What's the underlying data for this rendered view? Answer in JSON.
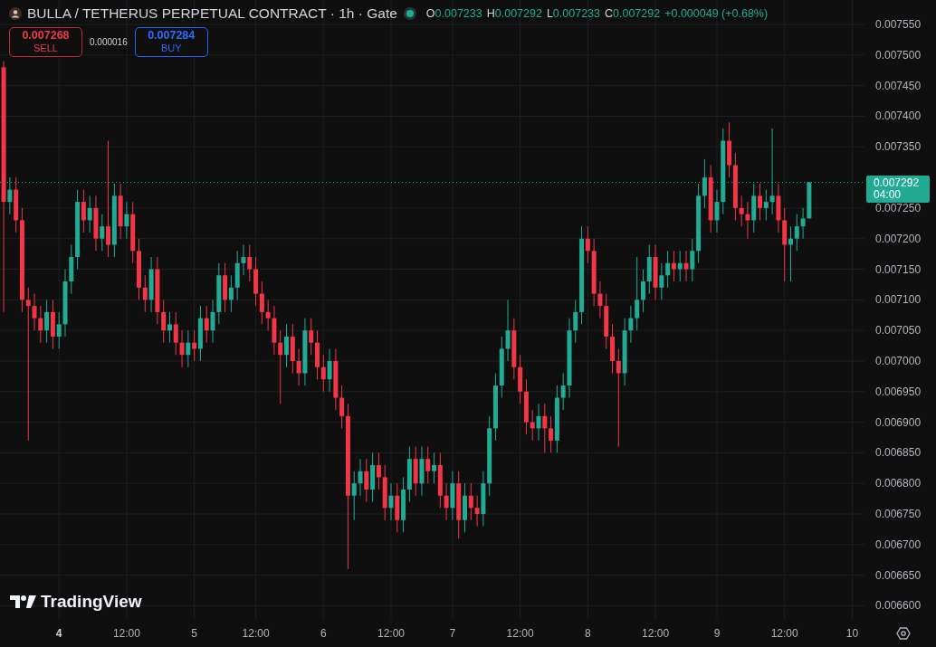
{
  "header": {
    "title": "BULLA / TETHERUS PERPETUAL CONTRACT · 1h · Gate",
    "ohlc": [
      {
        "label": "O",
        "value": "0.007233"
      },
      {
        "label": "H",
        "value": "0.007292"
      },
      {
        "label": "L",
        "value": "0.007233"
      },
      {
        "label": "C",
        "value": "0.007292"
      }
    ],
    "change": "+0.000049 (+0.68%)"
  },
  "trade": {
    "sell": {
      "price": "0.007268",
      "label": "SELL"
    },
    "spread": "0.000016",
    "buy": {
      "price": "0.007284",
      "label": "BUY"
    }
  },
  "chart": {
    "current": {
      "countdown": "04:00"
    },
    "chart_data": {
      "type": "candlestick",
      "ylim": [
        0.006577,
        0.00759
      ],
      "grid": true,
      "ref_lines": [
        {
          "axis": "y",
          "value": 0.007292,
          "label": "0.007292",
          "color": "#22ab94"
        }
      ],
      "categories": [
        null,
        null,
        null,
        null,
        null,
        null,
        null,
        null,
        null,
        "4",
        null,
        null,
        null,
        null,
        null,
        null,
        null,
        null,
        null,
        null,
        "12:00",
        null,
        null,
        null,
        null,
        null,
        null,
        null,
        null,
        null,
        null,
        "5",
        null,
        null,
        null,
        null,
        null,
        null,
        null,
        null,
        null,
        "12:00",
        null,
        null,
        null,
        null,
        null,
        null,
        null,
        null,
        null,
        null,
        "6",
        null,
        null,
        null,
        null,
        null,
        null,
        null,
        null,
        null,
        null,
        "12:00",
        null,
        null,
        null,
        null,
        null,
        null,
        null,
        null,
        null,
        "7",
        null,
        null,
        null,
        null,
        null,
        null,
        null,
        null,
        null,
        null,
        "12:00",
        null,
        null,
        null,
        null,
        null,
        null,
        null,
        null,
        null,
        null,
        "8",
        null,
        null,
        null,
        null,
        null,
        null,
        null,
        null,
        null,
        null,
        "12:00",
        null,
        null,
        null,
        null,
        null,
        null,
        null,
        null,
        null,
        "9",
        null,
        null,
        null,
        null,
        null,
        null,
        null,
        null,
        null,
        null,
        "12:00",
        null,
        null,
        null,
        null,
        null,
        null,
        null,
        null,
        null,
        null,
        "10"
      ],
      "yticks": [
        {
          "value": 0.00755,
          "label": "0.007550"
        },
        {
          "value": 0.0075,
          "label": "0.007500"
        },
        {
          "value": 0.00745,
          "label": "0.007450"
        },
        {
          "value": 0.0074,
          "label": "0.007400"
        },
        {
          "value": 0.00735,
          "label": "0.007350"
        },
        {
          "value": 0.00725,
          "label": "0.007250"
        },
        {
          "value": 0.0072,
          "label": "0.007200"
        },
        {
          "value": 0.00715,
          "label": "0.007150"
        },
        {
          "value": 0.0071,
          "label": "0.007100"
        },
        {
          "value": 0.00705,
          "label": "0.007050"
        },
        {
          "value": 0.007,
          "label": "0.007000"
        },
        {
          "value": 0.00695,
          "label": "0.006950"
        },
        {
          "value": 0.0069,
          "label": "0.006900"
        },
        {
          "value": 0.00685,
          "label": "0.006850"
        },
        {
          "value": 0.0068,
          "label": "0.006800"
        },
        {
          "value": 0.00675,
          "label": "0.006750"
        },
        {
          "value": 0.0067,
          "label": "0.006700"
        },
        {
          "value": 0.00665,
          "label": "0.006650"
        },
        {
          "value": 0.0066,
          "label": "0.006600"
        }
      ],
      "ohlc": [
        [
          0.00748,
          0.00749,
          0.00708,
          0.00726
        ],
        [
          0.00726,
          0.0073,
          0.00724,
          0.00728
        ],
        [
          0.00728,
          0.0073,
          0.00721,
          0.00723
        ],
        [
          0.00723,
          0.00725,
          0.00708,
          0.0071
        ],
        [
          0.0071,
          0.00712,
          0.00687,
          0.00709
        ],
        [
          0.00709,
          0.00711,
          0.00705,
          0.00707
        ],
        [
          0.00707,
          0.00709,
          0.00703,
          0.00705
        ],
        [
          0.00705,
          0.0071,
          0.00703,
          0.00708
        ],
        [
          0.00708,
          0.0071,
          0.00702,
          0.00704
        ],
        [
          0.00704,
          0.00708,
          0.00702,
          0.00706
        ],
        [
          0.00706,
          0.00715,
          0.00704,
          0.00713
        ],
        [
          0.00713,
          0.00719,
          0.00711,
          0.00717
        ],
        [
          0.00717,
          0.00728,
          0.00715,
          0.00726
        ],
        [
          0.00726,
          0.00728,
          0.00721,
          0.00723
        ],
        [
          0.00723,
          0.00727,
          0.00721,
          0.00725
        ],
        [
          0.00725,
          0.00727,
          0.00718,
          0.0072
        ],
        [
          0.0072,
          0.00724,
          0.00718,
          0.00722
        ],
        [
          0.00722,
          0.00736,
          0.00717,
          0.00719
        ],
        [
          0.00719,
          0.00729,
          0.00717,
          0.00727
        ],
        [
          0.00727,
          0.00729,
          0.0072,
          0.00722
        ],
        [
          0.00722,
          0.00726,
          0.0072,
          0.00724
        ],
        [
          0.00724,
          0.00726,
          0.00716,
          0.00718
        ],
        [
          0.00718,
          0.0072,
          0.0071,
          0.00712
        ],
        [
          0.00712,
          0.00714,
          0.00708,
          0.0071
        ],
        [
          0.0071,
          0.00717,
          0.00708,
          0.00715
        ],
        [
          0.00715,
          0.00717,
          0.00706,
          0.00708
        ],
        [
          0.00708,
          0.0071,
          0.00703,
          0.00705
        ],
        [
          0.00705,
          0.00708,
          0.00703,
          0.00706
        ],
        [
          0.00706,
          0.00708,
          0.00701,
          0.00703
        ],
        [
          0.00703,
          0.00705,
          0.00699,
          0.00701
        ],
        [
          0.00701,
          0.00705,
          0.00699,
          0.00703
        ],
        [
          0.00703,
          0.00705,
          0.007,
          0.00702
        ],
        [
          0.00702,
          0.00709,
          0.007,
          0.00707
        ],
        [
          0.00707,
          0.00709,
          0.00703,
          0.00705
        ],
        [
          0.00705,
          0.0071,
          0.00703,
          0.00708
        ],
        [
          0.00708,
          0.00716,
          0.00706,
          0.00714
        ],
        [
          0.00714,
          0.00716,
          0.00708,
          0.0071
        ],
        [
          0.0071,
          0.00714,
          0.00708,
          0.00712
        ],
        [
          0.00712,
          0.00718,
          0.0071,
          0.00716
        ],
        [
          0.00716,
          0.00719,
          0.00714,
          0.00717
        ],
        [
          0.00717,
          0.00719,
          0.00713,
          0.00715
        ],
        [
          0.00715,
          0.00717,
          0.00709,
          0.00711
        ],
        [
          0.00711,
          0.00713,
          0.00706,
          0.00708
        ],
        [
          0.00708,
          0.0071,
          0.00705,
          0.00707
        ],
        [
          0.00707,
          0.00709,
          0.00701,
          0.00703
        ],
        [
          0.00703,
          0.00705,
          0.00693,
          0.00701
        ],
        [
          0.00701,
          0.00706,
          0.00699,
          0.00704
        ],
        [
          0.00704,
          0.00706,
          0.00698,
          0.007
        ],
        [
          0.007,
          0.00702,
          0.00696,
          0.00698
        ],
        [
          0.00698,
          0.00707,
          0.00696,
          0.00705
        ],
        [
          0.00705,
          0.00707,
          0.00701,
          0.00703
        ],
        [
          0.00703,
          0.00705,
          0.00697,
          0.00699
        ],
        [
          0.00699,
          0.00701,
          0.00695,
          0.00697
        ],
        [
          0.00697,
          0.00702,
          0.00695,
          0.007
        ],
        [
          0.007,
          0.00702,
          0.00692,
          0.00694
        ],
        [
          0.00694,
          0.00696,
          0.00689,
          0.00691
        ],
        [
          0.00691,
          0.00693,
          0.00666,
          0.00678
        ],
        [
          0.00678,
          0.00682,
          0.00674,
          0.0068
        ],
        [
          0.0068,
          0.00684,
          0.00678,
          0.00682
        ],
        [
          0.00682,
          0.00684,
          0.00677,
          0.00679
        ],
        [
          0.00679,
          0.00685,
          0.00677,
          0.00683
        ],
        [
          0.00683,
          0.00685,
          0.00679,
          0.00681
        ],
        [
          0.00681,
          0.00683,
          0.00674,
          0.00676
        ],
        [
          0.00676,
          0.0068,
          0.00674,
          0.00678
        ],
        [
          0.00678,
          0.0068,
          0.00672,
          0.00674
        ],
        [
          0.00674,
          0.00681,
          0.00672,
          0.00679
        ],
        [
          0.00679,
          0.00686,
          0.00677,
          0.00684
        ],
        [
          0.00684,
          0.00686,
          0.00678,
          0.0068
        ],
        [
          0.0068,
          0.00686,
          0.00678,
          0.00684
        ],
        [
          0.00684,
          0.00686,
          0.0068,
          0.00682
        ],
        [
          0.00682,
          0.00685,
          0.0068,
          0.00683
        ],
        [
          0.00683,
          0.00685,
          0.00676,
          0.00678
        ],
        [
          0.00678,
          0.0068,
          0.00674,
          0.00676
        ],
        [
          0.00676,
          0.00682,
          0.00674,
          0.0068
        ],
        [
          0.0068,
          0.00682,
          0.00671,
          0.00674
        ],
        [
          0.00674,
          0.0068,
          0.00672,
          0.00678
        ],
        [
          0.00678,
          0.0068,
          0.00674,
          0.00676
        ],
        [
          0.00676,
          0.00678,
          0.00673,
          0.00675
        ],
        [
          0.00675,
          0.00682,
          0.00673,
          0.0068
        ],
        [
          0.0068,
          0.00691,
          0.00678,
          0.00689
        ],
        [
          0.00689,
          0.00698,
          0.00687,
          0.00696
        ],
        [
          0.00696,
          0.00704,
          0.00694,
          0.00702
        ],
        [
          0.00702,
          0.0071,
          0.007,
          0.00705
        ],
        [
          0.00705,
          0.00707,
          0.00697,
          0.00699
        ],
        [
          0.00699,
          0.00701,
          0.00693,
          0.00695
        ],
        [
          0.00695,
          0.00697,
          0.00688,
          0.0069
        ],
        [
          0.0069,
          0.00692,
          0.00687,
          0.00689
        ],
        [
          0.00689,
          0.00693,
          0.00687,
          0.00691
        ],
        [
          0.00691,
          0.00693,
          0.00685,
          0.00689
        ],
        [
          0.00689,
          0.00691,
          0.00685,
          0.00687
        ],
        [
          0.00687,
          0.00696,
          0.00685,
          0.00694
        ],
        [
          0.00694,
          0.00698,
          0.00692,
          0.00696
        ],
        [
          0.00696,
          0.00707,
          0.00694,
          0.00705
        ],
        [
          0.00705,
          0.0071,
          0.00703,
          0.00708
        ],
        [
          0.00708,
          0.00722,
          0.00706,
          0.0072
        ],
        [
          0.0072,
          0.00722,
          0.00716,
          0.00718
        ],
        [
          0.00718,
          0.0072,
          0.00709,
          0.00711
        ],
        [
          0.00711,
          0.00713,
          0.00707,
          0.00709
        ],
        [
          0.00709,
          0.00711,
          0.00702,
          0.00704
        ],
        [
          0.00704,
          0.00706,
          0.00698,
          0.007
        ],
        [
          0.007,
          0.00702,
          0.00686,
          0.00698
        ],
        [
          0.00698,
          0.00707,
          0.00696,
          0.00705
        ],
        [
          0.00705,
          0.00709,
          0.00703,
          0.00707
        ],
        [
          0.00707,
          0.00717,
          0.00705,
          0.0071
        ],
        [
          0.0071,
          0.00715,
          0.00708,
          0.00713
        ],
        [
          0.00713,
          0.00719,
          0.00711,
          0.00717
        ],
        [
          0.00717,
          0.00719,
          0.0071,
          0.00712
        ],
        [
          0.00712,
          0.00716,
          0.0071,
          0.00714
        ],
        [
          0.00714,
          0.00718,
          0.00712,
          0.00716
        ],
        [
          0.00716,
          0.00718,
          0.00713,
          0.00715
        ],
        [
          0.00715,
          0.00718,
          0.00713,
          0.00716
        ],
        [
          0.00716,
          0.00718,
          0.00713,
          0.00715
        ],
        [
          0.00715,
          0.0072,
          0.00713,
          0.00718
        ],
        [
          0.00718,
          0.00729,
          0.00716,
          0.00727
        ],
        [
          0.00727,
          0.00733,
          0.00725,
          0.0073
        ],
        [
          0.0073,
          0.00732,
          0.00721,
          0.00723
        ],
        [
          0.00723,
          0.00728,
          0.00721,
          0.00726
        ],
        [
          0.00726,
          0.00738,
          0.00724,
          0.00736
        ],
        [
          0.00736,
          0.00739,
          0.0073,
          0.00732
        ],
        [
          0.00732,
          0.00734,
          0.00723,
          0.00725
        ],
        [
          0.00725,
          0.00727,
          0.00722,
          0.00724
        ],
        [
          0.00724,
          0.00726,
          0.0072,
          0.00723
        ],
        [
          0.00723,
          0.00729,
          0.00721,
          0.00727
        ],
        [
          0.00727,
          0.00729,
          0.00723,
          0.00725
        ],
        [
          0.00725,
          0.00728,
          0.00723,
          0.00726
        ],
        [
          0.00726,
          0.00738,
          0.00724,
          0.00727
        ],
        [
          0.00727,
          0.00729,
          0.00721,
          0.00723
        ],
        [
          0.00723,
          0.00725,
          0.00713,
          0.00719
        ],
        [
          0.00719,
          0.00722,
          0.00713,
          0.0072
        ],
        [
          0.0072,
          0.00724,
          0.00718,
          0.00722
        ],
        [
          0.00722,
          0.00725,
          0.0072,
          0.007233
        ],
        [
          0.007233,
          0.007292,
          0.007233,
          0.007292
        ],
        null,
        null,
        null,
        null,
        null,
        null,
        null
      ]
    },
    "time_axis": {
      "labels_bold": [
        true,
        false,
        false,
        false,
        false,
        false,
        false,
        false,
        false,
        false,
        false,
        false,
        false
      ]
    }
  },
  "branding": {
    "text": "TradingView"
  }
}
